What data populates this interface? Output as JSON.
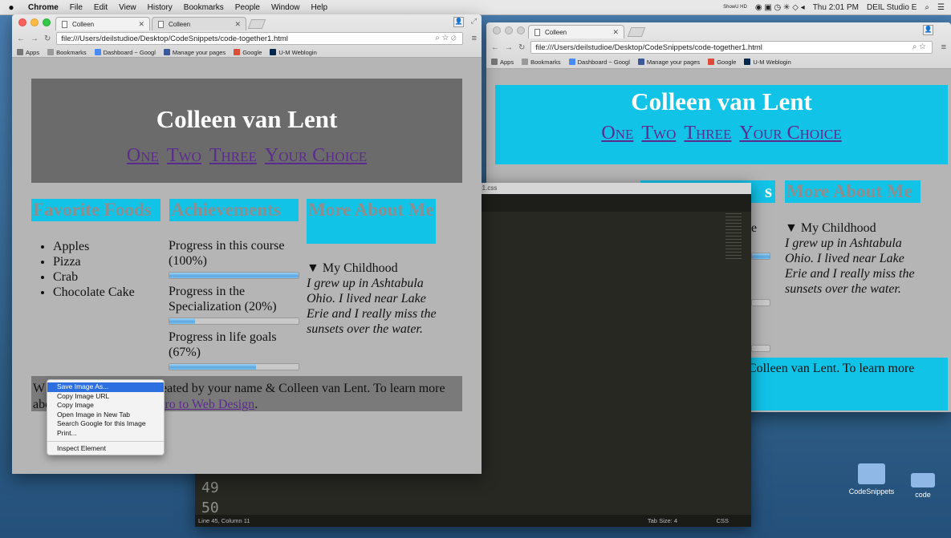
{
  "menubar": {
    "apple": "",
    "items": [
      "Chrome",
      "File",
      "Edit",
      "View",
      "History",
      "Bookmarks",
      "People",
      "Window",
      "Help"
    ],
    "status_small": "ShowU HD",
    "clock": "Thu 2:01 PM",
    "user": "DEIL Studio E"
  },
  "front_window": {
    "tabs": [
      {
        "title": "Colleen"
      },
      {
        "title": "Colleen"
      }
    ],
    "url": "file:///Users/deilstudioe/Desktop/CodeSnippets/code-together1.html",
    "bookmarks": [
      "Apps",
      "Bookmarks",
      "Dashboard ~ Googl",
      "Manage your pages",
      "Google",
      "U-M Weblogin"
    ],
    "header": {
      "title": "Colleen van Lent",
      "nav": [
        "One",
        "Two",
        "Three",
        "Your Choice"
      ]
    },
    "columns": {
      "foods_heading": "Favorite Foods",
      "foods": [
        "Apples",
        "Pizza",
        "Crab",
        "Chocolate Cake"
      ],
      "achievements_heading": "Achievements",
      "progress": [
        {
          "label": "Progress in this course (100%)",
          "value": 100
        },
        {
          "label": "Progress in the Specialization (20%)",
          "value": 20
        },
        {
          "label": "Progress in life goals (67%)",
          "value": 67
        }
      ],
      "more_heading": "More About Me",
      "childhood_summary": "▼ My Childhood",
      "childhood_text": "I grew up in Ashtabula Ohio. I lived near Lake Erie and I really miss the sunsets over the water."
    },
    "footer": {
      "prefix_visible": "W",
      "text_line1": "eated by your name & Colleen van Lent. To learn more",
      "text_line2_prefix": "abo",
      "link": "tro to Web Design",
      "text_end": "."
    }
  },
  "context_menu": {
    "items": [
      "Save Image As...",
      "Copy Image URL",
      "Copy Image",
      "Open Image in New Tab",
      "Search Google for this Image",
      "Print..."
    ],
    "inspect": "Inspect Element"
  },
  "back_window": {
    "tab": "Colleen",
    "url": "file:///Users/deilstudioe/Desktop/CodeSnippets/code-together1.html",
    "bookmarks": [
      "Apps",
      "Bookmarks",
      "Dashboard ~ Googl",
      "Manage your pages",
      "Google",
      "U-M Weblogin"
    ],
    "header": {
      "title": "Colleen van Lent",
      "nav": [
        "One",
        "Two",
        "Three",
        "Your Choice"
      ]
    },
    "more_heading": "More About Me",
    "partial_achievements": "s",
    "partial_e": "e",
    "childhood_summary": "▼ My Childhood",
    "childhood_text": "I grew up in Ashtabula Ohio. I lived near Lake Erie and I really miss the sunsets over the water.",
    "footer_line1": "Colleen van Lent. To learn more"
  },
  "editor": {
    "title_fragment": "-1.css",
    "line_numbers": [
      "49",
      "50"
    ],
    "status_left": "Line 45, Column 11",
    "tab_size": "Tab Size: 4",
    "language": "CSS"
  },
  "desktop": {
    "icons": [
      "CodeSnippets",
      "code"
    ]
  },
  "colors": {
    "cyan": "#12c3e8",
    "header_grey": "#6b6b6b",
    "link_purple": "#5b2c8e",
    "menu_highlight": "#2d6fe0"
  }
}
